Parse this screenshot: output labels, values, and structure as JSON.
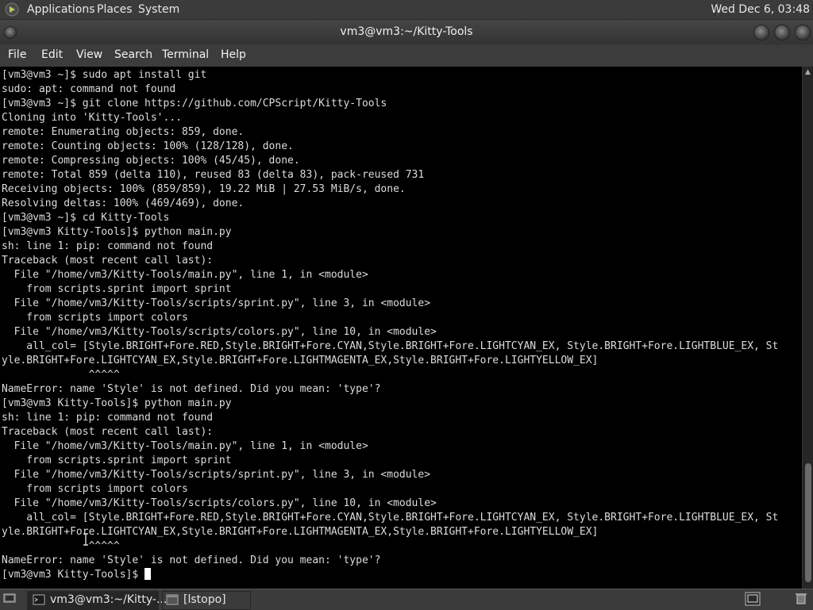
{
  "panel": {
    "menus": [
      "Applications",
      "Places",
      "System"
    ],
    "clock": "Wed Dec  6, 03:48"
  },
  "window": {
    "title": "vm3@vm3:~/Kitty-Tools"
  },
  "menubar": {
    "items": [
      "File",
      "Edit",
      "View",
      "Search",
      "Terminal",
      "Help"
    ]
  },
  "terminal": {
    "lines": [
      "[vm3@vm3 ~]$ sudo apt install git",
      "sudo: apt: command not found",
      "[vm3@vm3 ~]$ git clone https://github.com/CPScript/Kitty-Tools",
      "Cloning into 'Kitty-Tools'...",
      "remote: Enumerating objects: 859, done.",
      "remote: Counting objects: 100% (128/128), done.",
      "remote: Compressing objects: 100% (45/45), done.",
      "remote: Total 859 (delta 110), reused 83 (delta 83), pack-reused 731",
      "Receiving objects: 100% (859/859), 19.22 MiB | 27.53 MiB/s, done.",
      "Resolving deltas: 100% (469/469), done.",
      "[vm3@vm3 ~]$ cd Kitty-Tools",
      "[vm3@vm3 Kitty-Tools]$ python main.py",
      "sh: line 1: pip: command not found",
      "Traceback (most recent call last):",
      "  File \"/home/vm3/Kitty-Tools/main.py\", line 1, in <module>",
      "    from scripts.sprint import sprint",
      "  File \"/home/vm3/Kitty-Tools/scripts/sprint.py\", line 3, in <module>",
      "    from scripts import colors",
      "  File \"/home/vm3/Kitty-Tools/scripts/colors.py\", line 10, in <module>",
      "    all_col= [Style.BRIGHT+Fore.RED,Style.BRIGHT+Fore.CYAN,Style.BRIGHT+Fore.LIGHTCYAN_EX, Style.BRIGHT+Fore.LIGHTBLUE_EX, St",
      "yle.BRIGHT+Fore.LIGHTCYAN_EX,Style.BRIGHT+Fore.LIGHTMAGENTA_EX,Style.BRIGHT+Fore.LIGHTYELLOW_EX]",
      "              ^^^^^",
      "NameError: name 'Style' is not defined. Did you mean: 'type'?",
      "[vm3@vm3 Kitty-Tools]$ python main.py",
      "sh: line 1: pip: command not found",
      "Traceback (most recent call last):",
      "  File \"/home/vm3/Kitty-Tools/main.py\", line 1, in <module>",
      "    from scripts.sprint import sprint",
      "  File \"/home/vm3/Kitty-Tools/scripts/sprint.py\", line 3, in <module>",
      "    from scripts import colors",
      "  File \"/home/vm3/Kitty-Tools/scripts/colors.py\", line 10, in <module>",
      "    all_col= [Style.BRIGHT+Fore.RED,Style.BRIGHT+Fore.CYAN,Style.BRIGHT+Fore.LIGHTCYAN_EX, Style.BRIGHT+Fore.LIGHTBLUE_EX, St",
      "yle.BRIGHT+Fore.LIGHTCYAN_EX,Style.BRIGHT+Fore.LIGHTMAGENTA_EX,Style.BRIGHT+Fore.LIGHTYELLOW_EX]",
      "              ^^^^^",
      "NameError: name 'Style' is not defined. Did you mean: 'type'?"
    ],
    "prompt": "[vm3@vm3 Kitty-Tools]$ "
  },
  "taskbar": {
    "tasks": [
      "vm3@vm3:~/Kitty-...",
      "[lstopo]"
    ]
  },
  "colors": {
    "panel_bg": "#3b3b3b",
    "terminal_bg": "#000000",
    "terminal_fg": "#dcdcdc"
  }
}
